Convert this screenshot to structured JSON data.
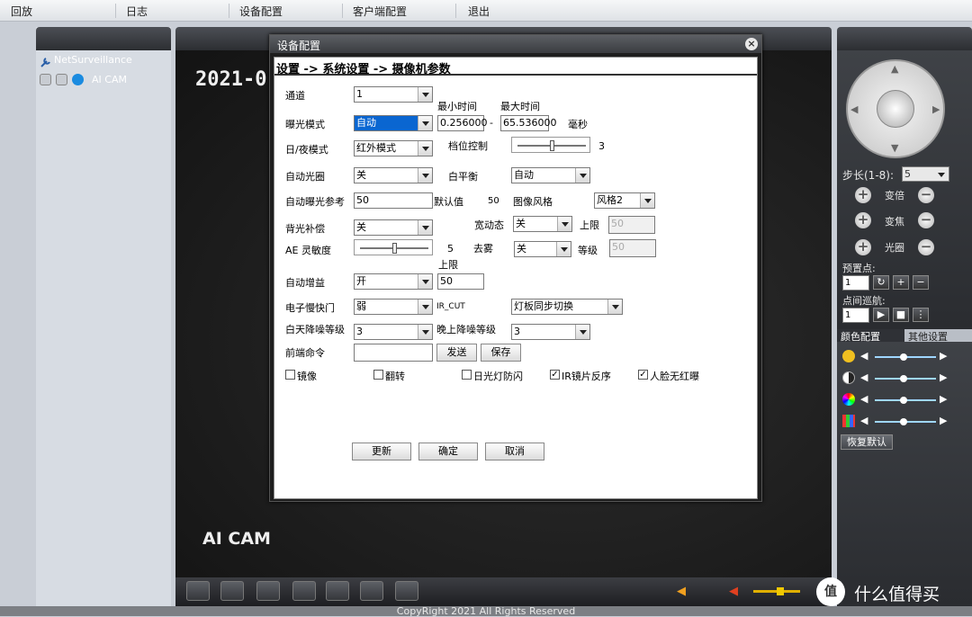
{
  "nav": {
    "items": [
      "回放",
      "日志",
      "设备配置",
      "客户端配置",
      "退出"
    ]
  },
  "left": {
    "device": "NetSurveillance",
    "channel": "AI CAM"
  },
  "video": {
    "timestamp": "2021-0",
    "cam_label": "AI CAM"
  },
  "dialog": {
    "title": "设备配置",
    "close": "×",
    "breadcrumb": "设置 -> 系统设置 -> 摄像机参数",
    "channel_label": "通道",
    "channel_value": "1",
    "min_time_label": "最小时间",
    "max_time_label": "最大时间",
    "exposure_label": "曝光模式",
    "exposure_value": "自动",
    "min_time_value": "0.256000",
    "dash": "-",
    "max_time_value": "65.536000",
    "ms_unit": "毫秒",
    "daynight_label": "日/夜模式",
    "daynight_value": "红外模式",
    "gear_label": "档位控制",
    "gear_value": "3",
    "gear_level": 0.5,
    "iris_label": "自动光圈",
    "iris_value": "关",
    "wb_label": "白平衡",
    "wb_value": "自动",
    "aeref_label": "自动曝光参考",
    "aeref_value": "50",
    "default_label": "默认值",
    "default_value": "50",
    "style_label": "图像风格",
    "style_value": "风格2",
    "blc_label": "背光补偿",
    "blc_value": "关",
    "wdr_label": "宽动态",
    "wdr_value": "关",
    "wdr_limit_label": "上限",
    "wdr_limit_value": "50",
    "ae_label": "AE 灵敏度",
    "ae_value": "5",
    "ae_level": 0.5,
    "defog_label": "去雾",
    "defog_value": "关",
    "defog_level_label": "等级",
    "defog_level_value": "50",
    "agc_limit_label": "上限",
    "agc_label": "自动增益",
    "agc_value": "开",
    "agc_limit_value": "50",
    "shutter_label": "电子慢快门",
    "shutter_value": "弱",
    "ircut_label": "IR_CUT",
    "ircut_value": "灯板同步切换",
    "dnr_day_label": "白天降噪等级",
    "dnr_day_value": "3",
    "dnr_night_label": "晚上降噪等级",
    "dnr_night_value": "3",
    "frontcmd_label": "前端命令",
    "frontcmd_value": "",
    "send_label": "发送",
    "save_label": "保存",
    "checks": [
      {
        "label": "镜像",
        "checked": false
      },
      {
        "label": "翻转",
        "checked": false
      },
      {
        "label": "日光灯防闪",
        "checked": false
      },
      {
        "label": "IR镜片反序",
        "checked": true
      },
      {
        "label": "人脸无红曝",
        "checked": true
      }
    ],
    "refresh_label": "更新",
    "ok_label": "确定",
    "cancel_label": "取消"
  },
  "right": {
    "step_label": "步长(1-8):",
    "step_value": "5",
    "zoom_label": "变倍",
    "focus_label": "变焦",
    "iris_label": "光圈",
    "preset_label": "预置点:",
    "preset_value": "1",
    "tour_label": "点间巡航:",
    "tour_value": "1",
    "tab_color": "颜色配置",
    "tab_other": "其他设置",
    "reset_label": "恢复默认"
  },
  "footer": {
    "copyright": "CopyRight 2021 All Rights Reserved"
  },
  "watermark": "什么值得买"
}
